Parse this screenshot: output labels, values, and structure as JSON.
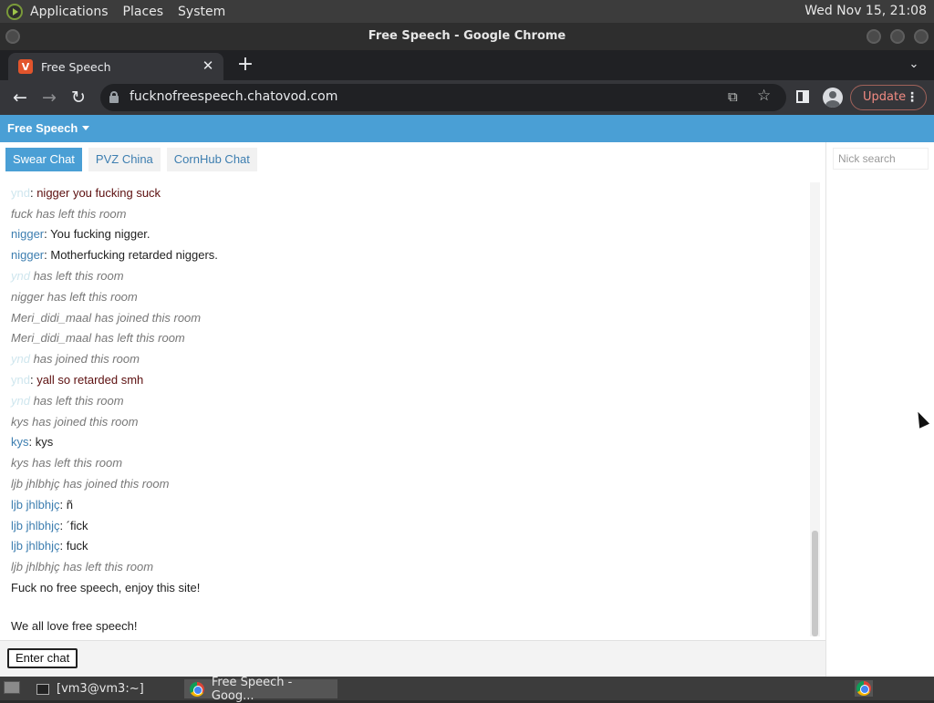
{
  "top_panel": {
    "menus": [
      "Applications",
      "Places",
      "System"
    ],
    "clock": "Wed Nov 15, 21:08"
  },
  "window": {
    "title": "Free Speech - Google Chrome"
  },
  "browser": {
    "tab_title": "Free Speech",
    "tab_close": "✕",
    "new_tab": "+",
    "url": "fucknofreespeech.chatovod.com",
    "update_label": "Update"
  },
  "site": {
    "brand": "Free Speech",
    "rooms": [
      {
        "label": "Swear Chat",
        "active": true
      },
      {
        "label": "PVZ China",
        "active": false
      },
      {
        "label": "CornHub Chat",
        "active": false
      }
    ],
    "messages": [
      {
        "nick": "ynd",
        "faded": true,
        "sep": ": ",
        "text": "nigger you fucking suck",
        "style": "red"
      },
      {
        "system": "fuck has left this room"
      },
      {
        "nick": "nigger",
        "sep": ": ",
        "text": "You fucking nigger."
      },
      {
        "nick": "nigger",
        "sep": ": ",
        "text": "Motherfucking retarded niggers."
      },
      {
        "nick": "ynd",
        "faded": true,
        "sys_tail": " has left this room"
      },
      {
        "system": "nigger has left this room"
      },
      {
        "system": "Meri_didi_maal has joined this room"
      },
      {
        "system": "Meri_didi_maal has left this room"
      },
      {
        "nick": "ynd",
        "faded": true,
        "sys_tail": " has joined this room"
      },
      {
        "nick": "ynd",
        "faded": true,
        "sep": ": ",
        "text": "yall so retarded smh",
        "style": "red"
      },
      {
        "nick": "ynd",
        "faded": true,
        "sys_tail": " has left this room"
      },
      {
        "system": "kys has joined this room"
      },
      {
        "nick": "kys",
        "sep": ": ",
        "text": "kys"
      },
      {
        "system": "kys has left this room"
      },
      {
        "system": "ljb jhlbhjç has joined this room"
      },
      {
        "nick": "ljb jhlbhjç",
        "sep": ": ",
        "text": "ñ"
      },
      {
        "nick": "ljb jhlbhjç",
        "sep": ": ",
        "text": "´fick"
      },
      {
        "nick": "ljb jhlbhjç",
        "sep": ": ",
        "text": "fuck"
      },
      {
        "system": "ljb jhlbhjç has left this room"
      },
      {
        "plain": "Fuck no free speech, enjoy this site!"
      },
      {
        "plain": "We all love free speech!"
      }
    ],
    "enter_chat": "Enter chat",
    "nick_search_placeholder": "Nick search"
  },
  "taskbar": {
    "tasks": [
      "[vm3@vm3:~]",
      "Free Speech - Goog..."
    ]
  }
}
